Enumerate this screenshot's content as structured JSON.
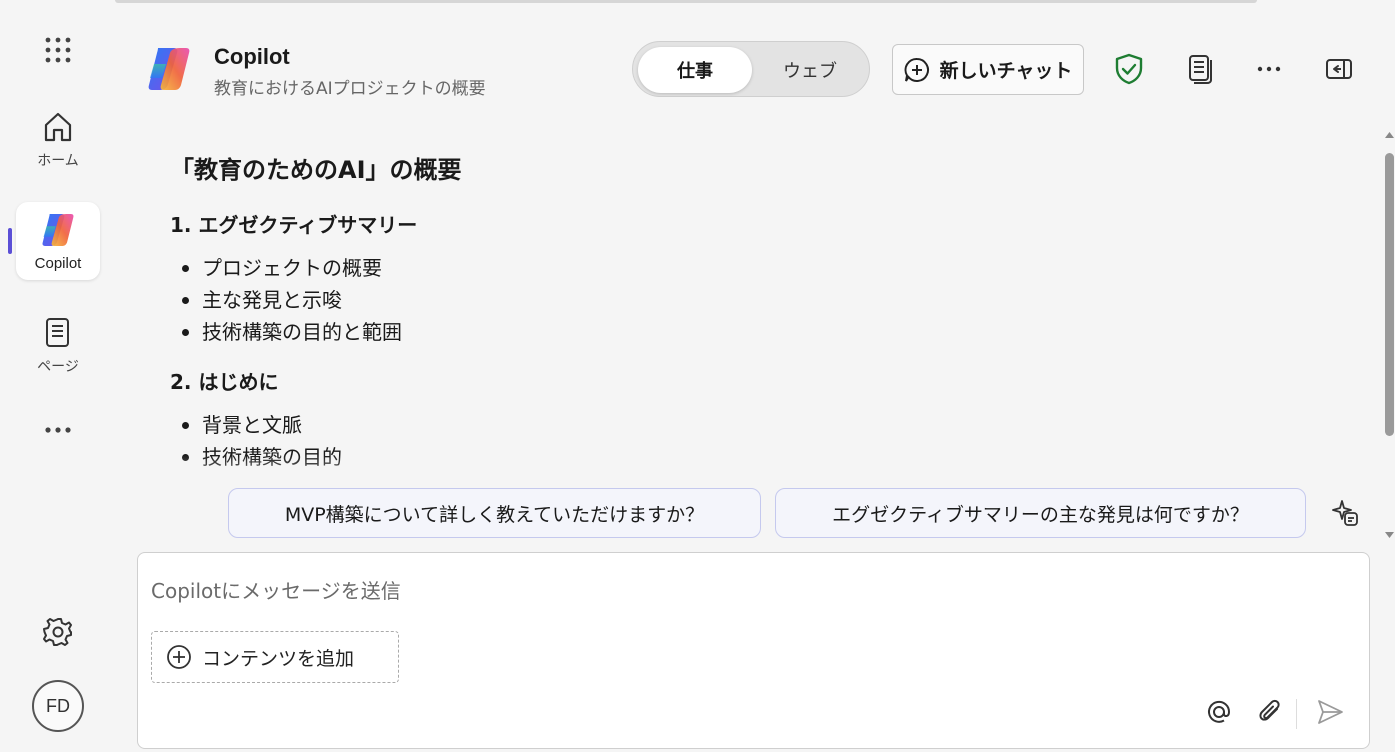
{
  "rail": {
    "items": [
      {
        "label": "ホーム",
        "icon": "home-icon"
      },
      {
        "label": "Copilot",
        "icon": "copilot-logo-icon"
      },
      {
        "label": "ページ",
        "icon": "page-icon"
      }
    ],
    "avatar_initials": "FD"
  },
  "header": {
    "title": "Copilot",
    "subtitle": "教育におけるAIプロジェクトの概要",
    "mode_toggle": {
      "selected": "仕事",
      "other": "ウェブ"
    },
    "new_chat_label": "新しいチャット"
  },
  "content": {
    "heading": "「教育のためのAI」の概要",
    "sections": [
      {
        "title": "1. エグゼクティブサマリー",
        "bullets": [
          "プロジェクトの概要",
          "主な発見と示唆",
          "技術構築の目的と範囲"
        ]
      },
      {
        "title": "2. はじめに",
        "bullets": [
          "背景と文脈",
          "技術構築の目的"
        ]
      }
    ]
  },
  "suggestions": [
    "MVP構築について詳しく教えていただけますか？",
    "エグゼクティブサマリーの主な発見は何ですか？"
  ],
  "composer": {
    "placeholder": "Copilotにメッセージを送信",
    "add_content_label": "コンテンツを追加"
  },
  "colors": {
    "accent": "#5b4fd6",
    "shield": "#1e7d32",
    "suggestion_border": "#c5c9ee"
  }
}
